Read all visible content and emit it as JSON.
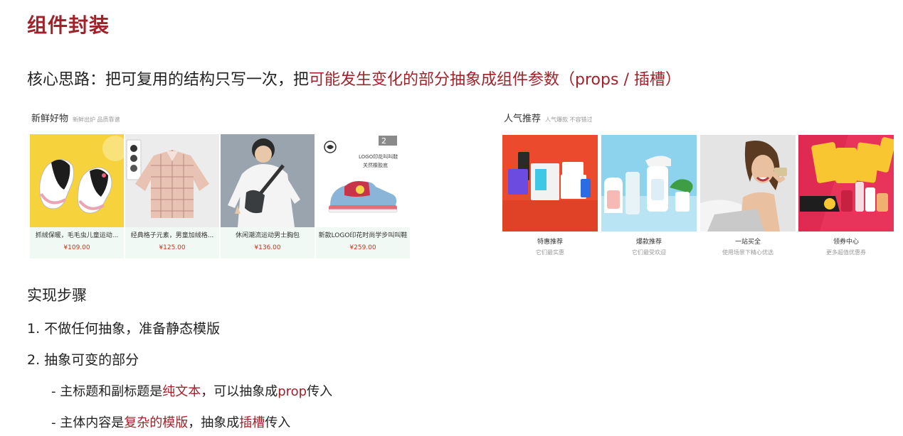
{
  "title": "组件封装",
  "core": {
    "prefix": "核心思路：把可复用的结构只写一次，把",
    "highlight": "可能发生变化的部分抽象成组件参数",
    "suffix": "（props / 插槽）"
  },
  "fresh_panel": {
    "title": "新鲜好物",
    "subtitle": "新鲜出炉 品质靠谱",
    "goods": [
      {
        "name": "抓绒保暖，毛毛虫儿童运动...",
        "price": "¥109.00"
      },
      {
        "name": "经典格子元素，男童加绒格...",
        "price": "¥125.00"
      },
      {
        "name": "休闲潮流运动男士胸包",
        "price": "¥136.00"
      },
      {
        "name": "新款LOGO印花时尚学步叫叫鞋",
        "price": "¥259.00"
      }
    ],
    "shoe_tag": "2",
    "shoe_caption_1": "LOGO印花叫叫鞋",
    "shoe_caption_2": "关然橡胶底"
  },
  "popular_panel": {
    "title": "人气推荐",
    "subtitle": "人气爆款 不容错过",
    "items": [
      {
        "name": "特惠推荐",
        "desc": "它们最实惠"
      },
      {
        "name": "爆款推荐",
        "desc": "它们最受欢迎"
      },
      {
        "name": "一站买全",
        "desc": "使用场景下精心优选"
      },
      {
        "name": "领券中心",
        "desc": "更多超值优惠券"
      }
    ]
  },
  "steps": {
    "title": "实现步骤",
    "step1": "1. 不做任何抽象，准备静态模版",
    "step2": "2. 抽象可变的部分",
    "sub1": {
      "prefix": "- 主标题和副标题是",
      "highlight": "纯文本",
      "mid": "，可以抽象成",
      "highlight2": "prop",
      "suffix": "传入"
    },
    "sub2": {
      "prefix": "- 主体内容是",
      "highlight": "复杂的模版",
      "mid": "，抽象成",
      "highlight2": "插槽",
      "suffix": "传入"
    }
  },
  "colors": {
    "accent": "#a0232b",
    "price": "#c7341e"
  }
}
